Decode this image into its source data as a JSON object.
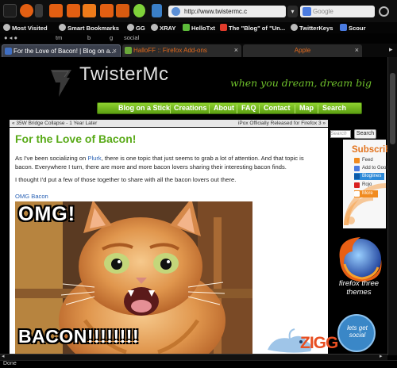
{
  "toolbar": {
    "url": "http://www.twistermc.c",
    "search_placeholder": "Google"
  },
  "bookmarks": [
    {
      "label": "Most Visited",
      "icon": "gear-icon"
    },
    {
      "label": "Smart Bookmarks",
      "icon": "gear-icon"
    },
    {
      "label": "GG",
      "icon": "gg-icon"
    },
    {
      "label": "XRAY",
      "icon": "xray-icon"
    },
    {
      "label": "HelloTxt",
      "icon": "hellotxt-icon"
    },
    {
      "label": "The \"Blog\" of \"Un...",
      "icon": "blog-icon"
    },
    {
      "label": "TwitterKeys",
      "icon": "twitter-icon"
    },
    {
      "label": "Scour",
      "icon": "scour-icon"
    }
  ],
  "second_bar": {
    "items": [
      "tm",
      "b",
      "g",
      "social"
    ]
  },
  "tabs": [
    {
      "label": "For the Love of Bacon! | Blog on a...",
      "active": true
    },
    {
      "label": "HalloFF :: Firefox Add-ons",
      "active": false
    },
    {
      "label": "Apple",
      "active": false
    }
  ],
  "site": {
    "title": "TwisterMc",
    "tagline": "when you dream, dream big",
    "nav": [
      "Blog on a Stick",
      "Creations",
      "About",
      "FAQ",
      "Contact",
      "Map",
      "Search"
    ]
  },
  "breadcrumb": {
    "previous": "« 35W Bridge Collapse - 1 Year Later",
    "next": "iPox Officially Released for Firefox 3 »"
  },
  "post": {
    "title": "For the Love of Bacon!",
    "para1_a": "As I've been socializing on ",
    "para1_link": "Plurk",
    "para1_b": ", there is one topic that just seems to grab a lot of attention.  And that topic is bacon.  Everywhere I turn, there are more and more bacon lovers sharing their interesting bacon finds.",
    "para2": "I thought I'd put a few of those together to share with all the bacon lovers out there.",
    "omg_link": "OMG Bacon",
    "meme_top": "OMG!",
    "meme_bottom": "BACON!!!!!!!!"
  },
  "sidebar": {
    "search_label": "Search",
    "search_button": "Search",
    "subscribe_title": "Subscribe",
    "subscribe_items": [
      {
        "label": "Feed",
        "color": "#f18b1f"
      },
      {
        "label": "Add to Google",
        "color": "#4a7be0"
      },
      {
        "label": "Bloglines",
        "color": "#2d8ad8"
      },
      {
        "label": "Rojo",
        "color": "#d92121"
      },
      {
        "label": "More",
        "color": "#f18b1f"
      }
    ],
    "firefox_caption_1": "firefox three",
    "firefox_caption_2": "themes",
    "social_1": "lets get",
    "social_2": "social"
  },
  "footer": {
    "brand": "ZIGG",
    "status": "Done"
  },
  "colors": {
    "accent_green": "#6ec02b",
    "nav_green": "#8ed22f",
    "tab_inactive_text": "#e46a1c"
  }
}
